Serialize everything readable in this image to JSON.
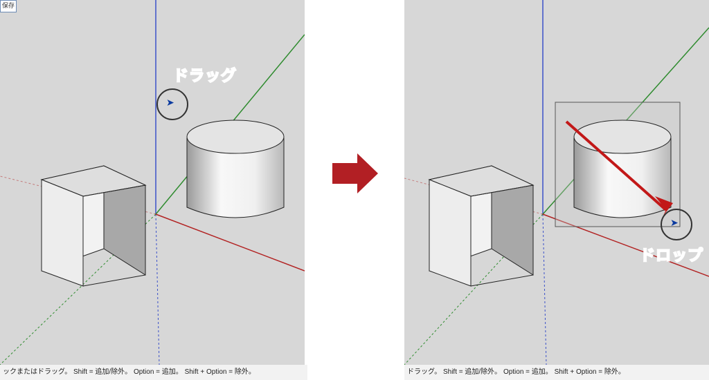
{
  "diagram": {
    "type": "instructional-side-by-side",
    "software_hint": "SketchUp",
    "action": "drag-to-drop selection box around cylinder"
  },
  "left_panel": {
    "toolbar_button": "保存",
    "annotation": "ドラッグ",
    "statusbar": "ックまたはドラッグ。 Shift = 追加/除外。 Option = 追加。 Shift + Option = 除外。"
  },
  "right_panel": {
    "annotation": "ドロップ",
    "statusbar": "ドラッグ。 Shift = 追加/除外。 Option = 追加。 Shift + Option = 除外。"
  },
  "colors": {
    "ground": "#d7d7d7",
    "axis_x": "#b22222",
    "axis_y": "#2e8b2e",
    "axis_z": "#3a50c9",
    "arrow": "#b21f24",
    "select_arrow": "#c21818"
  }
}
